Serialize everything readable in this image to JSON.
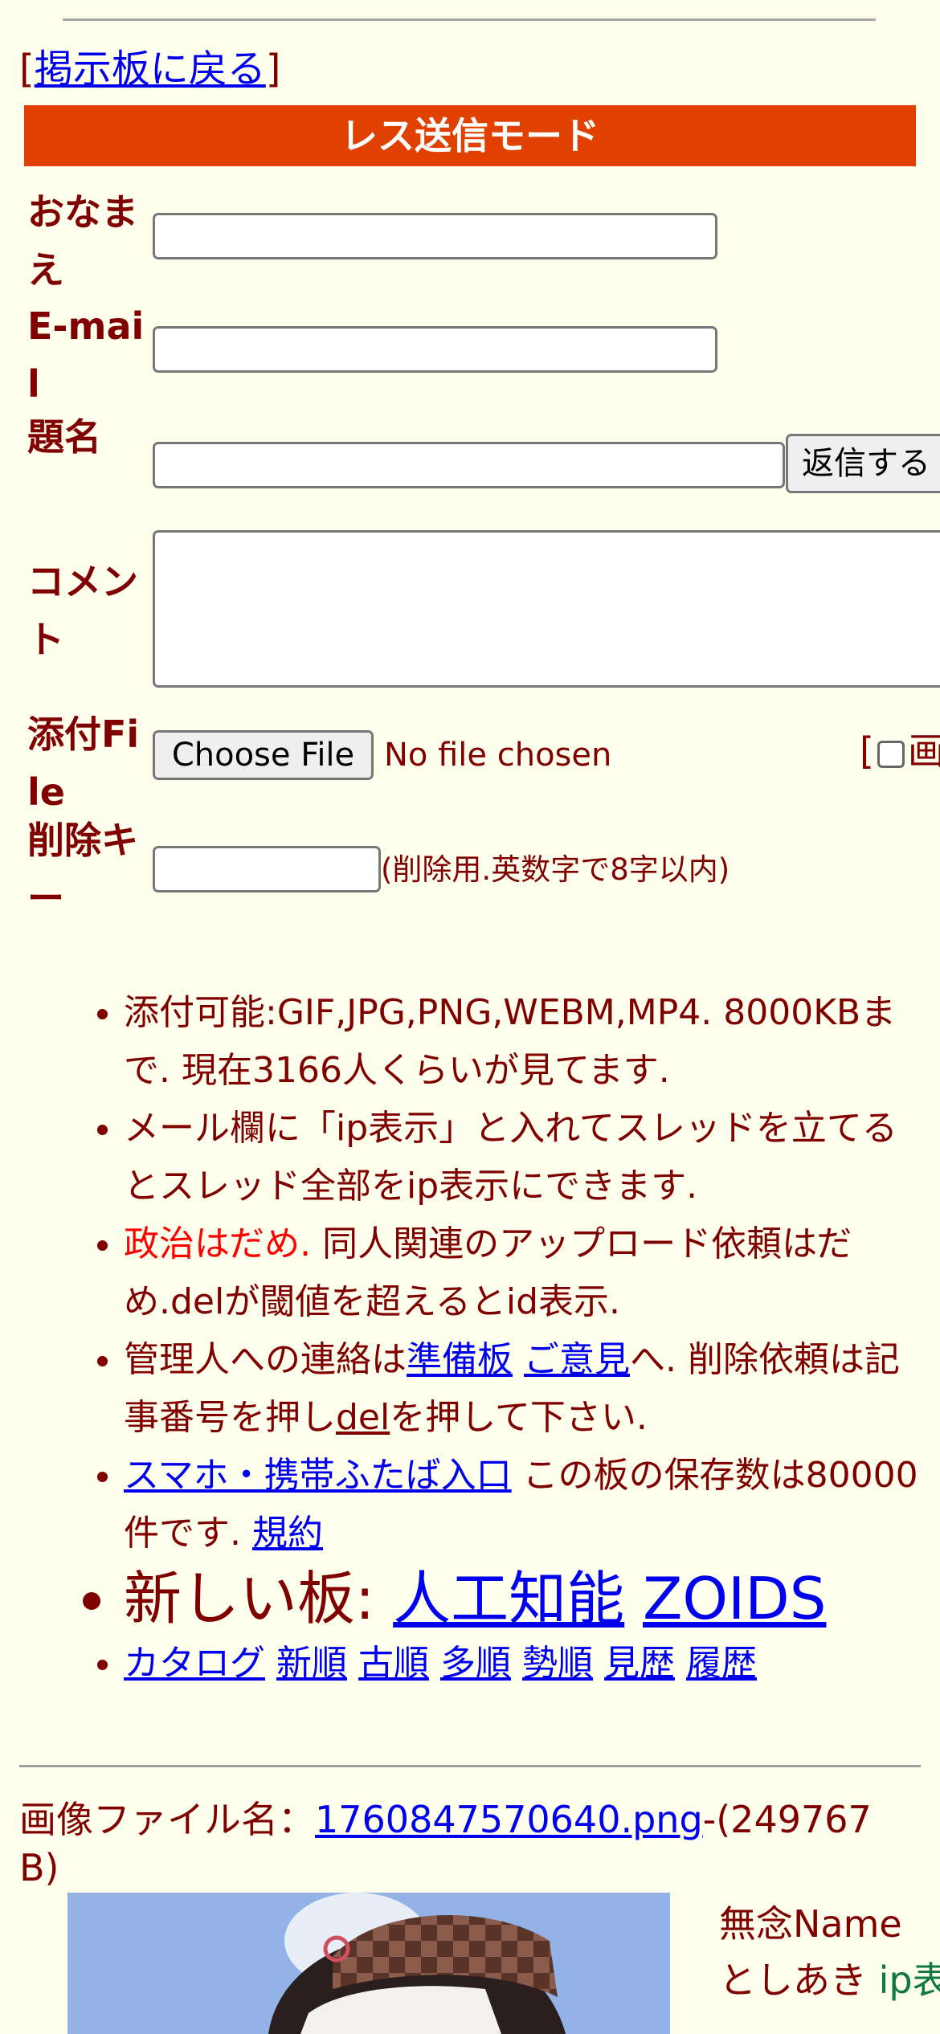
{
  "nav": {
    "back_open": "[",
    "back_link": "掲示板に戻る",
    "back_close": "]"
  },
  "form": {
    "mode_title": "レス送信モード",
    "name_label": "おなまえ",
    "email_label": "E-mail",
    "subject_label": "題名",
    "submit_label": "返信する",
    "comment_label": "コメント",
    "attach_label": "添付File",
    "choose_file_label": "Choose File",
    "no_file_text": "No file chosen",
    "image_option_bracket": "[",
    "image_option_text": "画",
    "delkey_label": "削除キー",
    "delkey_note": "(削除用.英数字で8字以内)"
  },
  "rules": {
    "r1": "添付可能:GIF,JPG,PNG,WEBM,MP4. 8000KBまで. 現在3166人くらいが見てます.",
    "r2": "メール欄に「ip表示」と入れてスレッドを立てるとスレッド全部をip表示にできます.",
    "r3_red": "政治はだめ.",
    "r3_rest": " 同人関連のアップロード依頼はだめ.delが閾値を超えるとid表示.",
    "r4_a": "管理人への連絡は",
    "r4_link1": "準備板",
    "r4_link2": "ご意見",
    "r4_b": "へ. 削除依頼は記事番号を押し",
    "r4_del": "del",
    "r4_c": "を押して下さい.",
    "r5_link": "スマホ・携帯ふたば入口",
    "r5_text": " この板の保存数は80000件です. ",
    "r5_terms": "規約",
    "r6_text": "新しい板: ",
    "r6_link1": "人工知能",
    "r6_link2": "ZOIDS",
    "nav_links": [
      "カタログ",
      "新順",
      "古順",
      "多順",
      "勢順",
      "見歴",
      "履歴"
    ]
  },
  "post": {
    "file_label": "画像ファイル名：",
    "file_name": "1760847570640.png",
    "file_size": "-(249767 B)",
    "name": "無念Name",
    "author": "としあき",
    "ip_label": "ip表示"
  },
  "colors": {
    "background": "#ffffee",
    "text": "#800000",
    "accent": "#e04000",
    "link": "#0000ee",
    "alert": "#ff0000",
    "name_green": "#117743"
  }
}
